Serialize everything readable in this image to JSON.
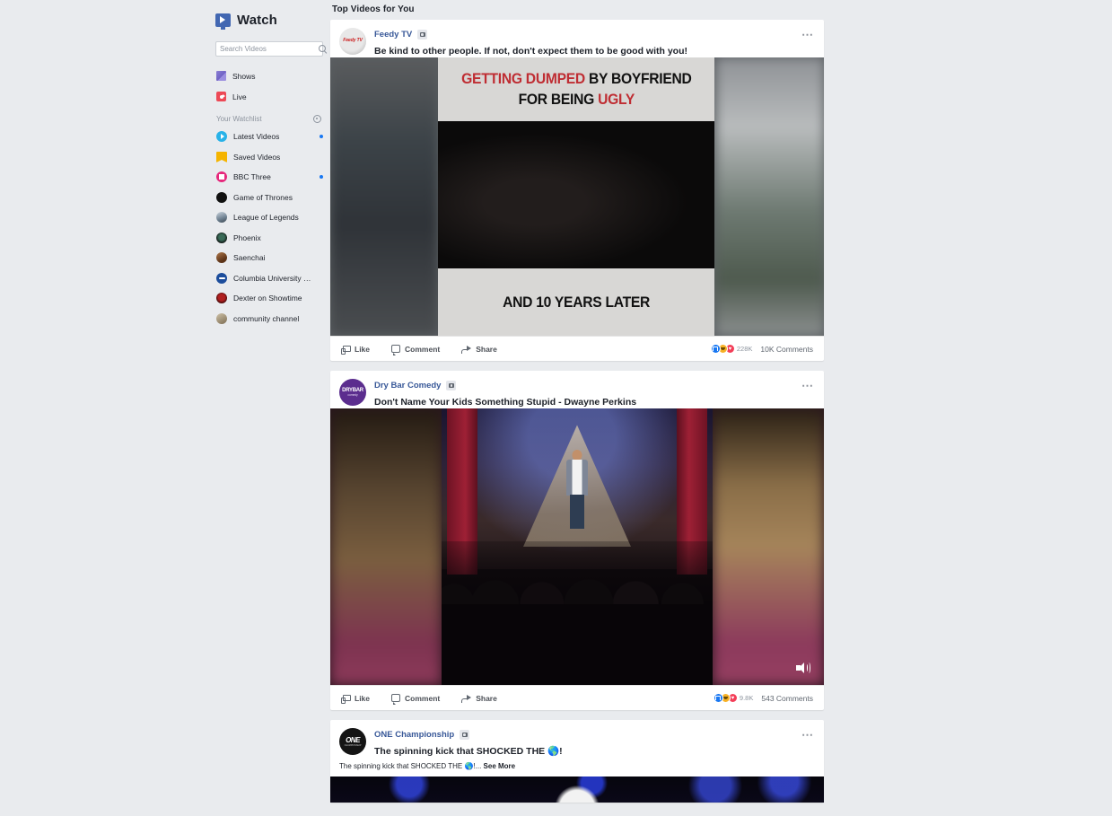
{
  "app": {
    "title": "Watch",
    "logo_icon": "facebook-watch-icon"
  },
  "search": {
    "placeholder": "Search Videos",
    "value": "",
    "icon": "search-icon"
  },
  "sidebar": {
    "nav": [
      {
        "label": "Shows",
        "icon": "shows-icon"
      },
      {
        "label": "Live",
        "icon": "live-icon"
      }
    ],
    "watchlist": {
      "title": "Your Watchlist",
      "settings_icon": "gear-icon",
      "items": [
        {
          "label": "Latest Videos",
          "icon": "play-circle-avatar",
          "unread": true
        },
        {
          "label": "Saved Videos",
          "icon": "bookmark-avatar",
          "unread": false
        },
        {
          "label": "BBC Three",
          "icon": "bbc-three-avatar",
          "unread": true
        },
        {
          "label": "Game of Thrones",
          "icon": "game-of-thrones-avatar",
          "unread": false
        },
        {
          "label": "League of Legends",
          "icon": "league-of-legends-avatar",
          "unread": false
        },
        {
          "label": "Phoenix",
          "icon": "phoenix-avatar",
          "unread": false
        },
        {
          "label": "Saenchai",
          "icon": "saenchai-avatar",
          "unread": false
        },
        {
          "label": "Columbia University in ...",
          "icon": "columbia-university-avatar",
          "unread": false
        },
        {
          "label": "Dexter on Showtime",
          "icon": "dexter-avatar",
          "unread": false
        },
        {
          "label": "community channel",
          "icon": "community-channel-avatar",
          "unread": false
        }
      ]
    }
  },
  "feed": {
    "title": "Top Videos for You",
    "action_labels": {
      "like": "Like",
      "comment": "Comment",
      "share": "Share"
    },
    "menu_icon": "ellipsis-icon",
    "video_badge_icon": "video-badge-icon",
    "posts": [
      {
        "page": "Feedy TV",
        "text": "Be kind to other people. If not, don't expect them to be good with you!",
        "thumbnail": {
          "line1_red": "GETTING DUMPED",
          "line1_black": " BY BOYFRIEND",
          "line2_black": "FOR BEING ",
          "line2_red": "UGLY",
          "line3": "AND 10 YEARS LATER"
        },
        "reaction_count": "228K",
        "comment_count": "10K Comments"
      },
      {
        "page": "Dry Bar Comedy",
        "text": "Don't Name Your Kids Something Stupid - Dwayne Perkins",
        "reaction_count": "9.8K",
        "comment_count": "543 Comments",
        "sound_icon": "speaker-icon"
      },
      {
        "page": "ONE Championship",
        "text": "The spinning kick that SHOCKED THE 🌎!",
        "subtext": "The spinning kick that SHOCKED THE 🌎!...",
        "see_more": "See More"
      }
    ]
  },
  "colors": {
    "brand_blue": "#385898",
    "page_bg": "#e9ebee",
    "card_bg": "#ffffff",
    "accent_blue": "#1877f2",
    "muted_text": "#8d949e"
  }
}
